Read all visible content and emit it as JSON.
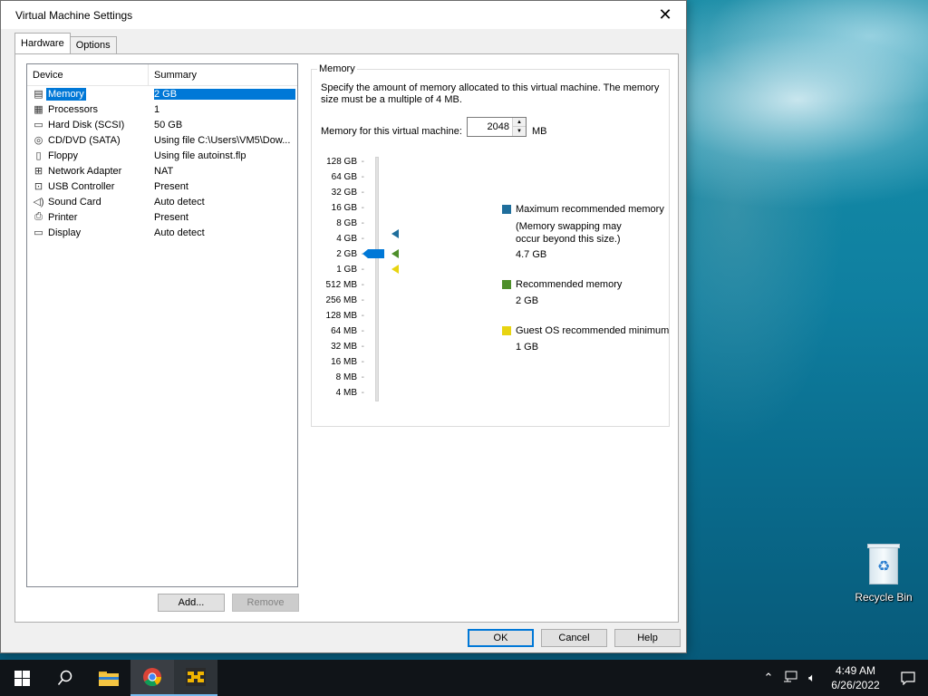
{
  "dialog": {
    "title": "Virtual Machine Settings",
    "close_glyph": "✕",
    "tabs": [
      {
        "label": "Hardware",
        "active": true
      },
      {
        "label": "Options",
        "active": false
      }
    ],
    "device_list": {
      "headers": {
        "device": "Device",
        "summary": "Summary"
      },
      "rows": [
        {
          "icon": "memory-icon",
          "glyph": "▤",
          "device": "Memory",
          "summary": "2 GB",
          "selected": true
        },
        {
          "icon": "processor-icon",
          "glyph": "▦",
          "device": "Processors",
          "summary": "1"
        },
        {
          "icon": "hard-disk-icon",
          "glyph": "▭",
          "device": "Hard Disk (SCSI)",
          "summary": "50 GB"
        },
        {
          "icon": "cd-dvd-icon",
          "glyph": "◎",
          "device": "CD/DVD (SATA)",
          "summary": "Using file C:\\Users\\VM5\\Dow..."
        },
        {
          "icon": "floppy-icon",
          "glyph": "▯",
          "device": "Floppy",
          "summary": "Using file autoinst.flp"
        },
        {
          "icon": "network-adapter-icon",
          "glyph": "⊞",
          "device": "Network Adapter",
          "summary": "NAT"
        },
        {
          "icon": "usb-controller-icon",
          "glyph": "⊡",
          "device": "USB Controller",
          "summary": "Present"
        },
        {
          "icon": "sound-card-icon",
          "glyph": "◁)",
          "device": "Sound Card",
          "summary": "Auto detect"
        },
        {
          "icon": "printer-icon",
          "glyph": "⎙",
          "device": "Printer",
          "summary": "Present"
        },
        {
          "icon": "display-icon",
          "glyph": "▭",
          "device": "Display",
          "summary": "Auto detect"
        }
      ]
    },
    "add_label": "Add...",
    "remove_label": "Remove",
    "memory": {
      "group_label": "Memory",
      "description": "Specify the amount of memory allocated to this virtual machine. The memory size must be a multiple of 4 MB.",
      "field_label": "Memory for this virtual machine:",
      "value": "2048",
      "unit": "MB",
      "scale_labels": [
        "128 GB",
        "64 GB",
        "32 GB",
        "16 GB",
        "8 GB",
        "4 GB",
        "2 GB",
        "1 GB",
        "512 MB",
        "256 MB",
        "128 MB",
        "64 MB",
        "32 MB",
        "16 MB",
        "8 MB",
        "4 MB"
      ],
      "legend": {
        "max": {
          "title": "Maximum recommended memory",
          "note": "(Memory swapping may occur beyond this size.)",
          "value": "4.7 GB",
          "color": "#1f6e9c"
        },
        "recommended": {
          "title": "Recommended memory",
          "value": "2 GB",
          "color": "#4e8f2a"
        },
        "minimum": {
          "title": "Guest OS recommended minimum",
          "value": "1 GB",
          "color": "#e8d411"
        }
      }
    },
    "buttons": {
      "ok": "OK",
      "cancel": "Cancel",
      "help": "Help"
    }
  },
  "desktop": {
    "recycle_bin_label": "Recycle Bin"
  },
  "taskbar": {
    "time": "4:49 AM",
    "date": "6/26/2022",
    "tray_icons": [
      "chevron-up-icon",
      "network-icon",
      "volume-icon"
    ]
  }
}
